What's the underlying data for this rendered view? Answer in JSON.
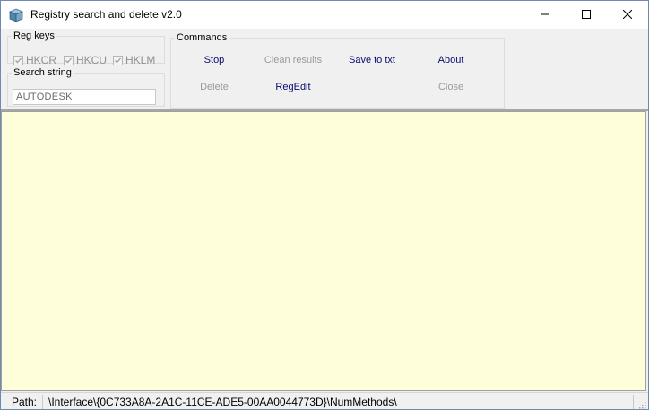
{
  "window": {
    "title": "Registry search and delete v2.0",
    "icon": "registry-cube-icon"
  },
  "titlebar_buttons": {
    "minimize_icon": "minimize-icon",
    "maximize_icon": "maximize-icon",
    "close_icon": "close-icon"
  },
  "reg_keys": {
    "legend": "Reg keys",
    "items": [
      {
        "label": "HKCR",
        "checked": true,
        "enabled": false
      },
      {
        "label": "HKCU",
        "checked": true,
        "enabled": false
      },
      {
        "label": "HKLM",
        "checked": true,
        "enabled": false
      }
    ]
  },
  "search": {
    "legend": "Search string",
    "value": "AUTODESK"
  },
  "commands": {
    "legend": "Commands",
    "stop": "Stop",
    "clean_results": "Clean results",
    "save_to_txt": "Save to txt",
    "about": "About",
    "delete": "Delete",
    "regedit": "RegEdit",
    "close": "Close"
  },
  "status": {
    "path_label": "Path:",
    "path_value": "\\Interface\\{0C733A8A-2A1C-11CE-ADE5-00AA0044773D}\\NumMethods\\"
  },
  "colors": {
    "results_background": "#fffedb",
    "enabled_command": "#0a0a6e",
    "disabled_command": "#9a9a9a"
  }
}
